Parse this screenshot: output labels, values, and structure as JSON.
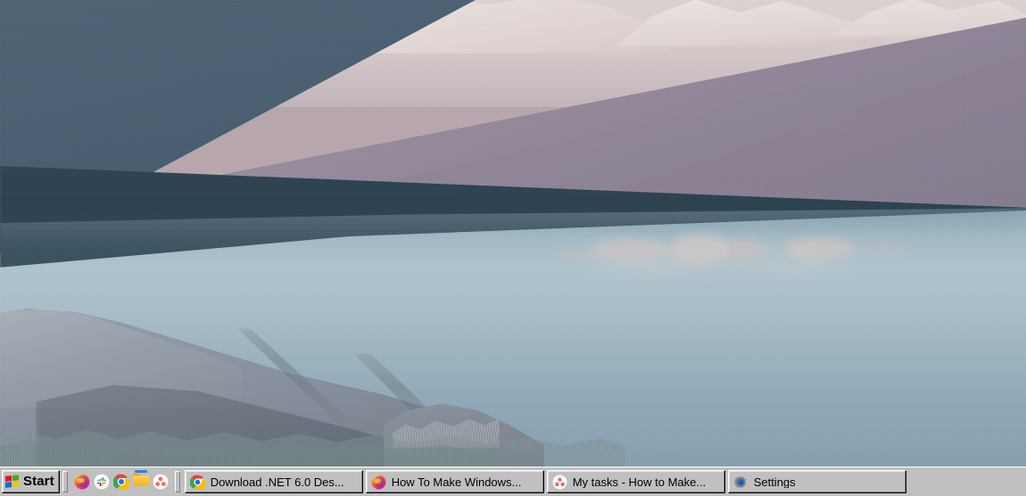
{
  "desktop": {
    "wallpaper_name": "desert-dunes-lake-wallpaper",
    "colors": {
      "sand_pale": "#ded3d3",
      "dune_mauve": "#94899b",
      "dune_shadow": "#45596b",
      "deep_shadow": "#2b404f",
      "water": "#a8c0cb",
      "water_deep": "#87a0b1",
      "rock": "#8c95a1",
      "grass": "#76888 8"
    }
  },
  "taskbar": {
    "start": {
      "label": "Start",
      "icon": "windows-flag-icon"
    },
    "quick_launch": {
      "items": [
        {
          "name": "firefox",
          "icon": "firefox-icon",
          "title": "Firefox"
        },
        {
          "name": "slack",
          "icon": "slack-icon",
          "title": "Slack"
        },
        {
          "name": "chrome",
          "icon": "chrome-icon",
          "title": "Google Chrome"
        },
        {
          "name": "file-explorer",
          "icon": "folder-icon",
          "title": "File Explorer"
        },
        {
          "name": "asana",
          "icon": "asana-icon",
          "title": "Asana"
        }
      ]
    },
    "tasks": [
      {
        "label": "Download .NET 6.0 Des...",
        "icon": "chrome-icon",
        "active": false
      },
      {
        "label": "How To Make Windows...",
        "icon": "firefox-icon",
        "active": false
      },
      {
        "label": "My tasks - How to Make...",
        "icon": "asana-icon",
        "active": false
      },
      {
        "label": "Settings",
        "icon": "gear-icon",
        "active": false
      }
    ]
  }
}
